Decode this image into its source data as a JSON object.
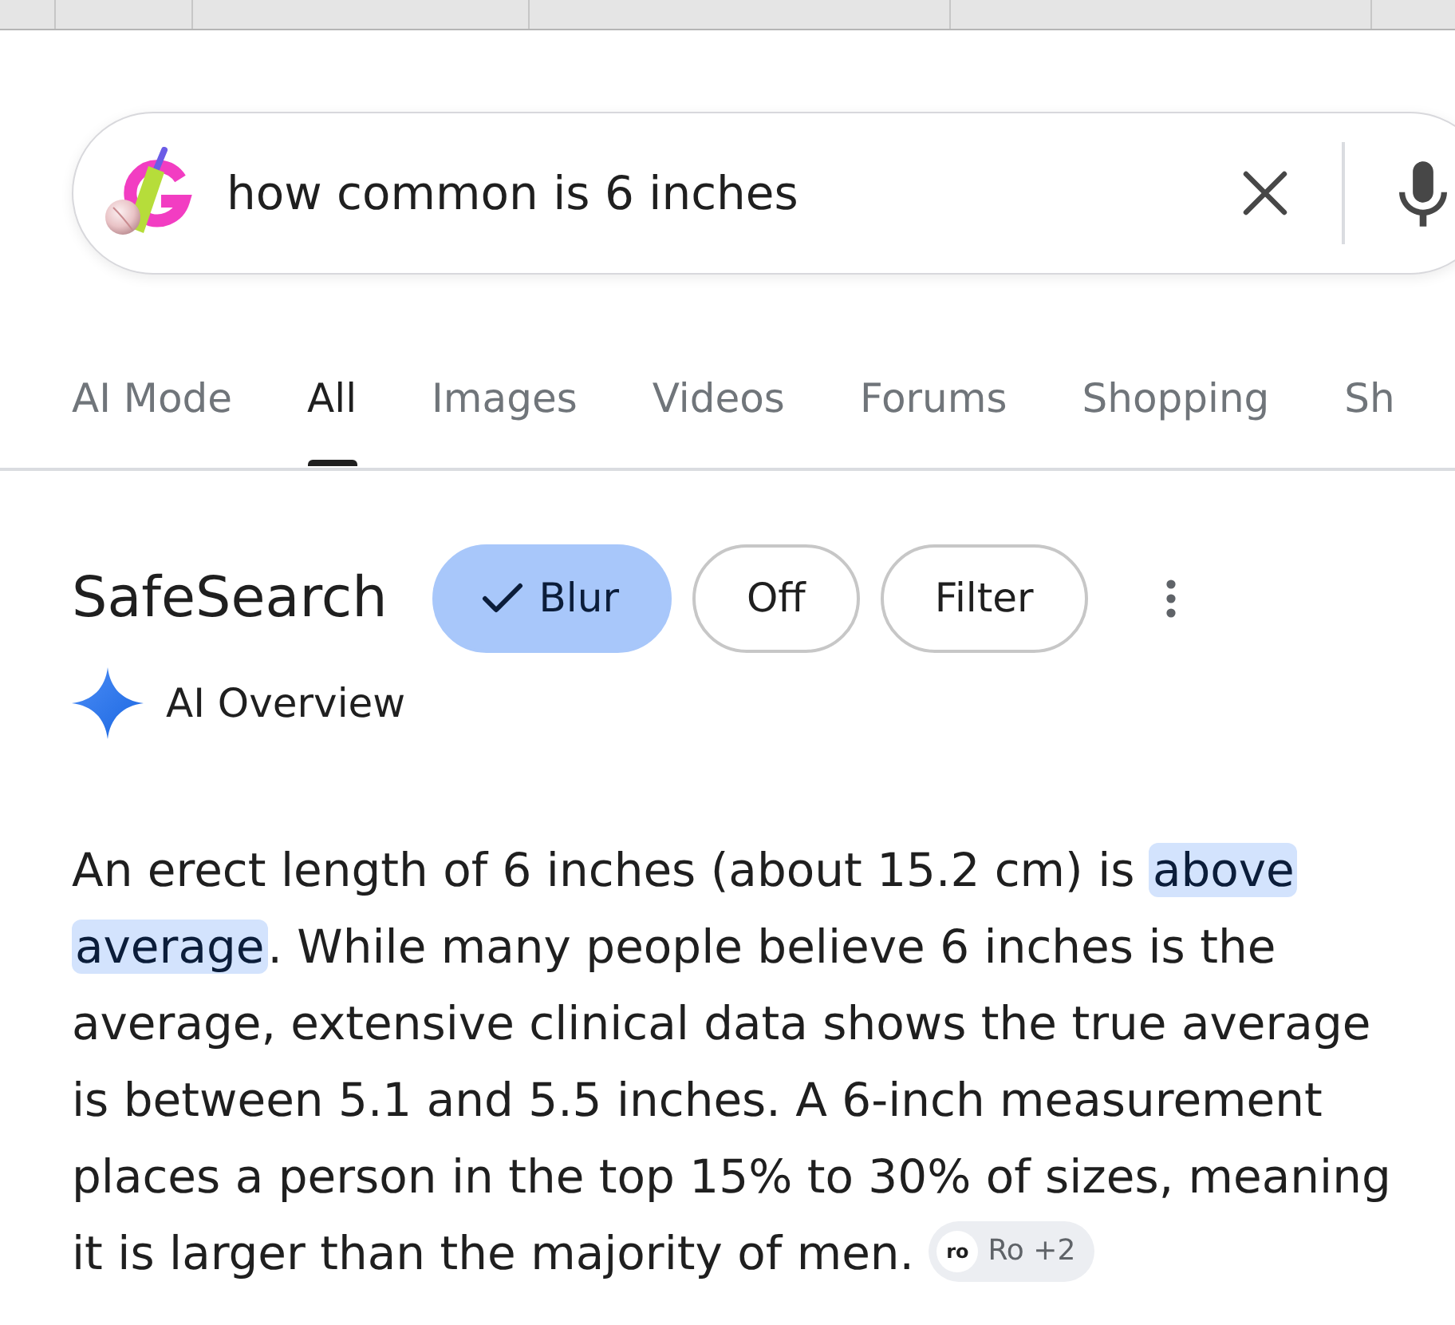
{
  "search": {
    "value": "how common is 6 inches"
  },
  "tabs": [
    {
      "label": "AI Mode",
      "selected": false
    },
    {
      "label": "All",
      "selected": true
    },
    {
      "label": "Images",
      "selected": false
    },
    {
      "label": "Videos",
      "selected": false
    },
    {
      "label": "Forums",
      "selected": false
    },
    {
      "label": "Shopping",
      "selected": false
    },
    {
      "label": "Sh",
      "selected": false
    }
  ],
  "safesearch": {
    "title": "SafeSearch",
    "options": [
      {
        "label": "Blur",
        "selected": true
      },
      {
        "label": "Off",
        "selected": false
      },
      {
        "label": "Filter",
        "selected": false
      }
    ]
  },
  "ai_overview": {
    "title": "AI Overview",
    "text": "An erect length of 6 inches (about 15.2 cm) is **above average**. While many people believe 6 inches is the average, extensive clinical data shows the true average is between 5.1 and 5.5 inches. A 6-inch measurement places a person in the top 15% to 30% of sizes, meaning it is larger than the majority of men.",
    "citation": {
      "favicon_text": "ro",
      "label": "Ro +2"
    }
  }
}
